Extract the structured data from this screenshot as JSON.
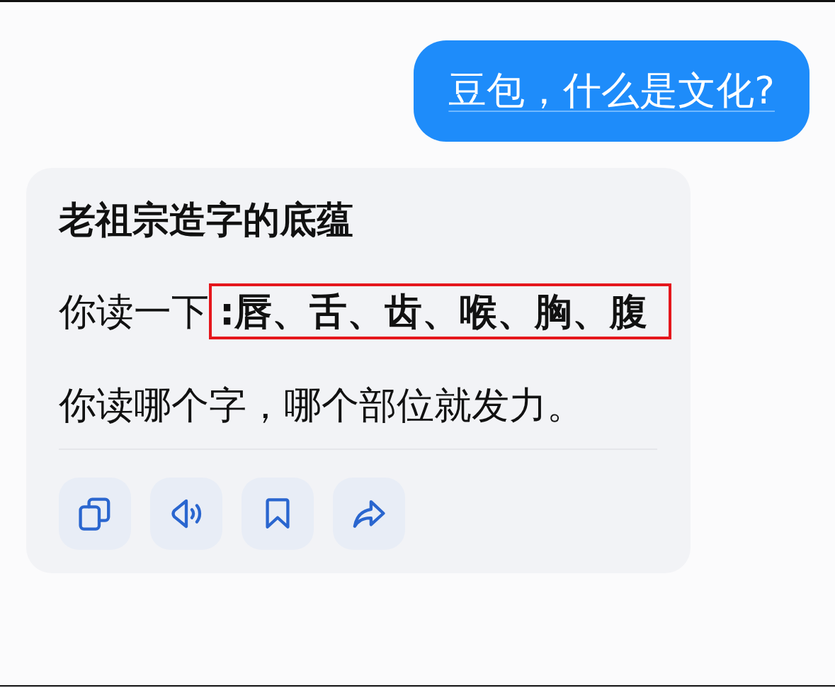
{
  "user_message": {
    "text": "豆包，什么是文化?"
  },
  "reply_card": {
    "title": "老祖宗造字的底蕴",
    "paragraphs": [
      {
        "segments": [
          {
            "text": "你读一下",
            "highlighted": false
          },
          {
            "text": ":唇、舌、齿、喉、胸、腹",
            "highlighted": true
          }
        ]
      },
      {
        "segments": [
          {
            "text": "你读哪个字，哪个部位就发力。",
            "highlighted": false
          }
        ]
      }
    ],
    "actions": [
      {
        "kind": "copy"
      },
      {
        "kind": "speaker"
      },
      {
        "kind": "bookmark"
      },
      {
        "kind": "share"
      }
    ]
  }
}
